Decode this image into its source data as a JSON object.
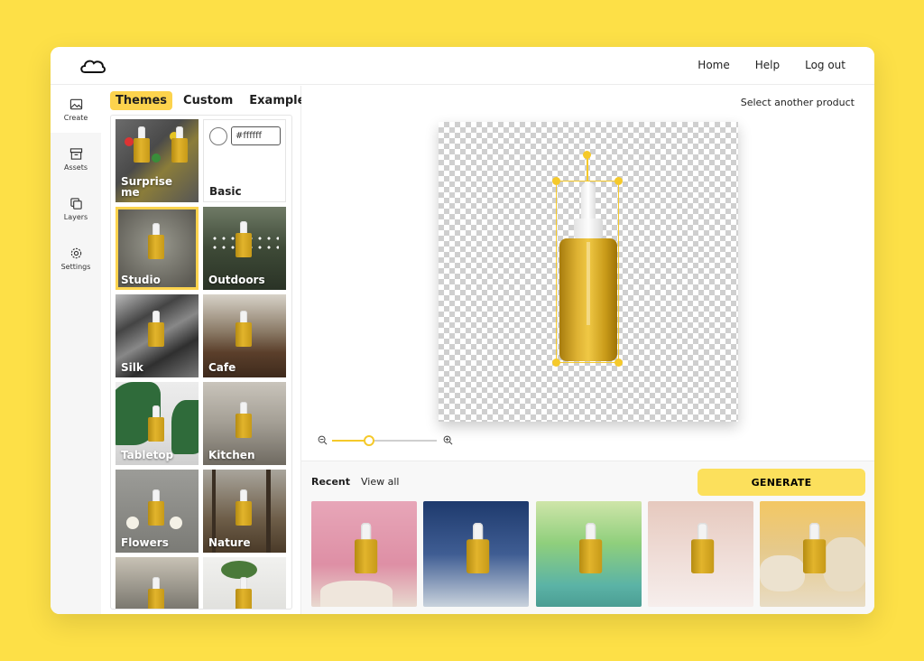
{
  "header": {
    "nav": [
      "Home",
      "Help",
      "Log out"
    ]
  },
  "rail": {
    "items": [
      {
        "label": "Create",
        "icon": "image-icon"
      },
      {
        "label": "Assets",
        "icon": "archive-icon"
      },
      {
        "label": "Layers",
        "icon": "layers-icon"
      },
      {
        "label": "Settings",
        "icon": "gear-icon"
      }
    ]
  },
  "themes": {
    "tabs": [
      "Themes",
      "Custom",
      "Examples"
    ],
    "active_tab": "Themes",
    "basic_color_value": "#ffffff",
    "tiles": [
      "Surprise me",
      "Basic",
      "Studio",
      "Outdoors",
      "Silk",
      "Cafe",
      "Tabletop",
      "Kitchen",
      "Flowers",
      "Nature",
      "",
      ""
    ],
    "selected": "Studio"
  },
  "editor": {
    "select_product": "Select another product",
    "zoom_level": 0.35
  },
  "recent": {
    "title": "Recent",
    "view_all": "View all",
    "generate": "GENERATE"
  },
  "colors": {
    "accent": "#FCD34D",
    "background": "#FDE047"
  }
}
